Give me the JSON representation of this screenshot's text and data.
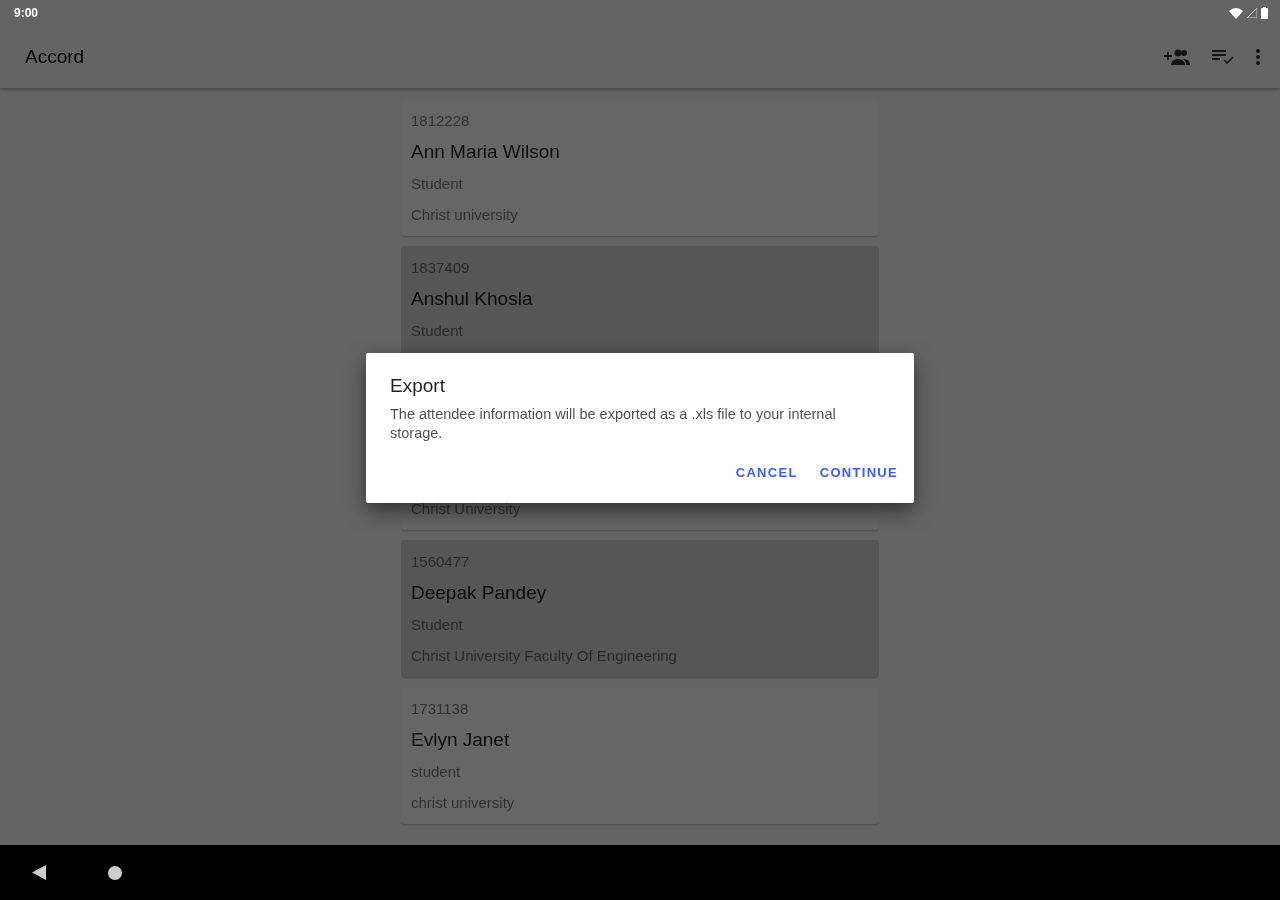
{
  "status_bar": {
    "time": "9:00"
  },
  "app_bar": {
    "title": "Accord"
  },
  "attendees": [
    {
      "id": "1812228",
      "name": "Ann Maria Wilson",
      "role": "Student",
      "institution": "Christ university",
      "selected": false
    },
    {
      "id": "1837409",
      "name": "Anshul Khosla",
      "role": "Student",
      "selected": true
    },
    {
      "institution": "Christ University",
      "selected": false
    },
    {
      "id": "1560477",
      "name": "Deepak Pandey",
      "role": "Student",
      "institution": "Christ University Faculty Of Engineering",
      "selected": true
    },
    {
      "id": "1731138",
      "name": "Evlyn Janet",
      "role": "student",
      "institution": "christ university",
      "selected": false
    }
  ],
  "dialog": {
    "title": "Export",
    "message": "The attendee information will be exported as a .xls file to your internal storage.",
    "buttons": [
      "CANCEL",
      "CONTINUE"
    ]
  }
}
